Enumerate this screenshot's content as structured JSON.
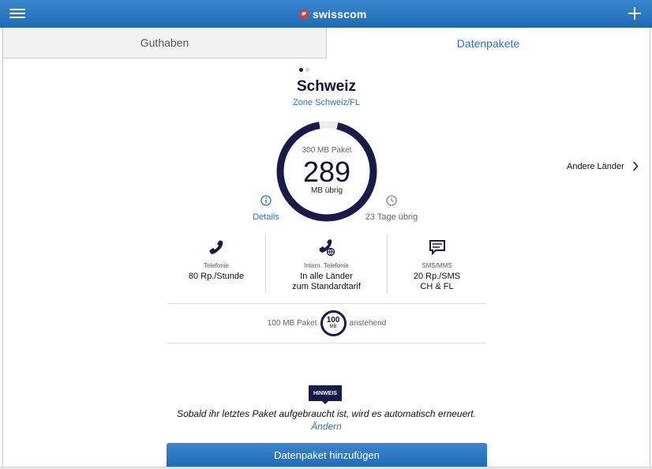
{
  "header": {
    "brand": "swisscom",
    "colors": {
      "bar": "#2878c4",
      "accent": "#2a74c0",
      "ring": "#1a1a4a"
    }
  },
  "tabs": [
    {
      "label": "Guthaben",
      "active": false
    },
    {
      "label": "Datenpakete",
      "active": true
    }
  ],
  "carousel": {
    "page": 1,
    "total": 2
  },
  "package": {
    "country": "Schweiz",
    "zone": "Zone Schweiz/FL",
    "size_label": "300 MB Paket",
    "remaining": "289",
    "unit_label": "MB übrig",
    "remaining_fraction": 0.963,
    "details_label": "Details",
    "days_label": "23 Tage übrig"
  },
  "other_countries_label": "Andere Länder",
  "rates": [
    {
      "icon": "phone-icon",
      "title": "Telefonie",
      "value_lines": [
        "80 Rp./Stunde"
      ]
    },
    {
      "icon": "international-phone-icon",
      "title": "Intern. Telefonie",
      "value_lines": [
        "In alle Länder",
        "zum Standardtarif"
      ]
    },
    {
      "icon": "sms-icon",
      "title": "SMS/MMS",
      "value_lines": [
        "20 Rp./SMS",
        "CH & FL"
      ]
    }
  ],
  "pending": {
    "prefix": "100 MB Paket",
    "badge_value": "100",
    "badge_unit": "MB",
    "suffix": "anstehend"
  },
  "hint": {
    "tag": "HINWEIS",
    "text": "Sobald ihr letztes Paket aufgebraucht ist, wird es automatisch erneuert.",
    "link": "Ändern"
  },
  "add_button_label": "Datenpaket hinzufügen"
}
